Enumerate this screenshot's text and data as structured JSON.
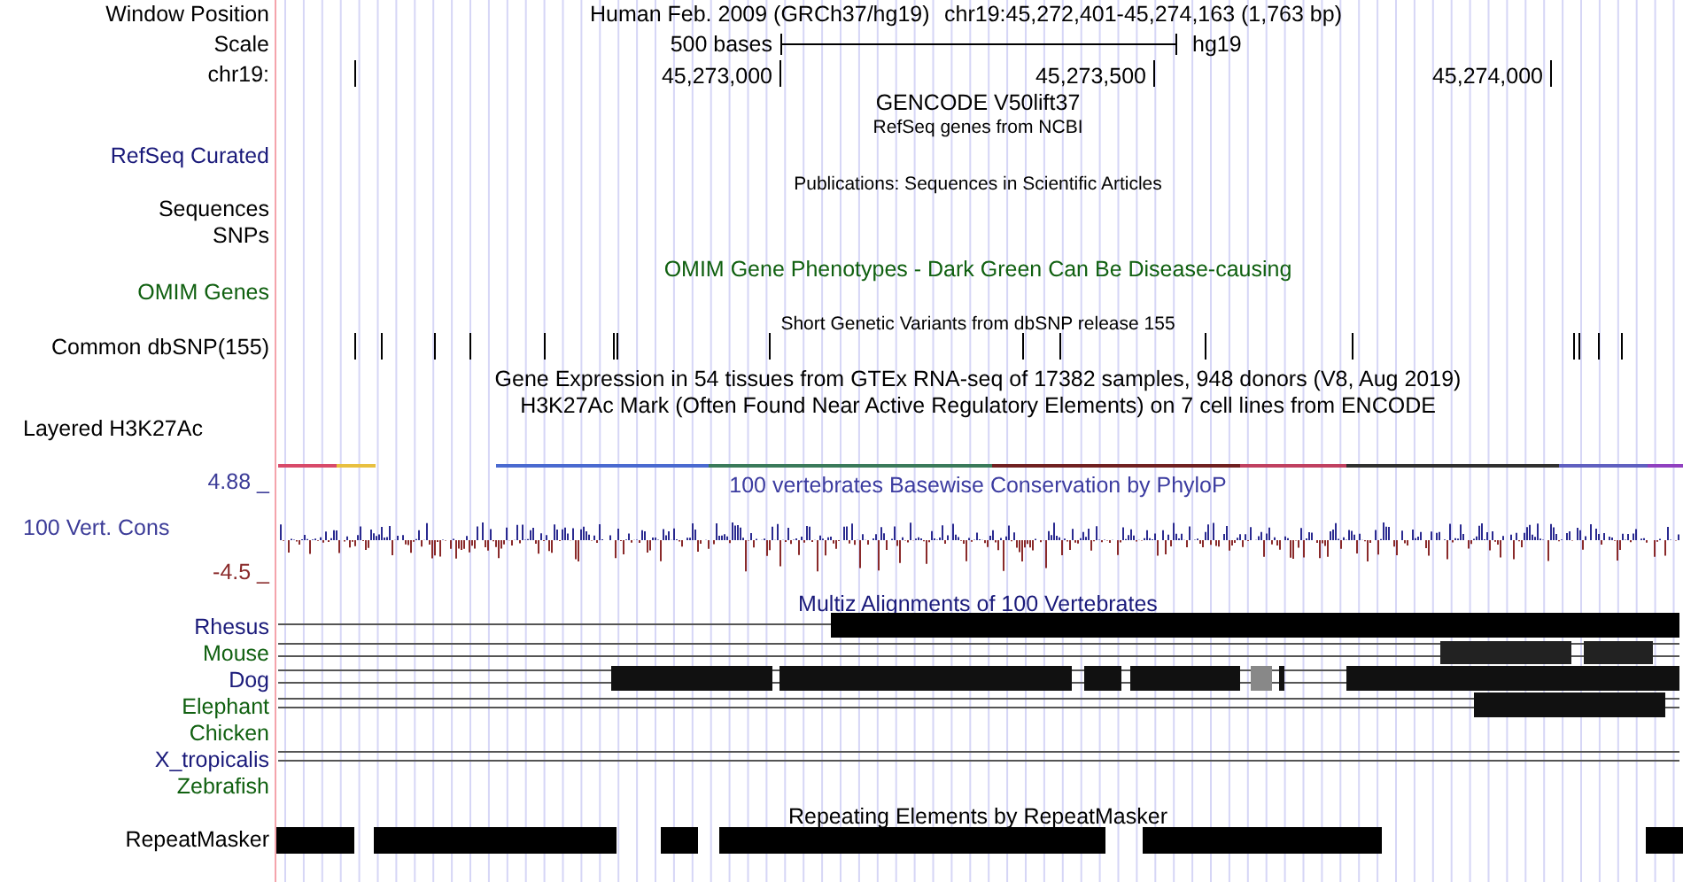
{
  "header": {
    "assembly": "Human Feb. 2009 (GRCh37/hg19)",
    "position": "chr19:45,272,401-45,274,163 (1,763 bp)"
  },
  "scale": {
    "label": "500 bases",
    "assembly": "hg19"
  },
  "ruler": {
    "ticks": [
      "45,273,000",
      "45,273,500",
      "45,274,000"
    ]
  },
  "track_labels": [
    {
      "text": "Window Position",
      "color": "#000000"
    },
    {
      "text": "Scale",
      "color": "#000000"
    },
    {
      "text": "chr19:",
      "color": "#000000"
    },
    {
      "text": "RefSeq Curated",
      "color": "#1a1a7a"
    },
    {
      "text": "Sequences",
      "color": "#000000"
    },
    {
      "text": "SNPs",
      "color": "#000000"
    },
    {
      "text": "OMIM Genes",
      "color": "#106010"
    },
    {
      "text": "Common dbSNP(155)",
      "color": "#000000"
    },
    {
      "text": "Layered H3K27Ac",
      "color": "#000000"
    },
    {
      "text": "4.88 _",
      "color": "#3c3c98"
    },
    {
      "text": "100 Vert. Cons",
      "color": "#3c3c98"
    },
    {
      "text": "-4.5 _",
      "color": "#8a2a2a"
    },
    {
      "text": "Rhesus",
      "color": "#1a1a7a"
    },
    {
      "text": "Mouse",
      "color": "#106010"
    },
    {
      "text": "Dog",
      "color": "#1a1a7a"
    },
    {
      "text": "Elephant",
      "color": "#106010"
    },
    {
      "text": "Chicken",
      "color": "#106010"
    },
    {
      "text": "X_tropicalis",
      "color": "#1a1a7a"
    },
    {
      "text": "Zebrafish",
      "color": "#106010"
    },
    {
      "text": "RepeatMasker",
      "color": "#000000"
    }
  ],
  "track_titles": [
    {
      "text": "GENCODE V50lift37",
      "kind": "title",
      "color": "#000000"
    },
    {
      "text": "RefSeq genes from NCBI",
      "kind": "subtitle",
      "color": "#000000"
    },
    {
      "text": "Publications: Sequences in Scientific Articles",
      "kind": "subtitle",
      "color": "#000000"
    },
    {
      "text": "OMIM Gene Phenotypes - Dark Green Can Be Disease-causing",
      "kind": "title",
      "color": "#106010"
    },
    {
      "text": "Short Genetic Variants from dbSNP release 155",
      "kind": "subtitle",
      "color": "#000000"
    },
    {
      "text": "Gene Expression in 54 tissues from GTEx RNA-seq of 17382 samples, 948 donors (V8, Aug 2019)",
      "kind": "title",
      "color": "#000000"
    },
    {
      "text": "H3K27Ac Mark (Often Found Near Active Regulatory Elements) on 7 cell lines from ENCODE",
      "kind": "title",
      "color": "#000000"
    },
    {
      "text": "100 vertebrates Basewise Conservation by PhyloP",
      "kind": "title",
      "color": "#3c3ca0"
    },
    {
      "text": "Multiz Alignments of 100 Vertebrates",
      "kind": "title",
      "color": "#1a1a7a"
    },
    {
      "text": "Repeating Elements by RepeatMasker",
      "kind": "title",
      "color": "#000000"
    }
  ]
}
